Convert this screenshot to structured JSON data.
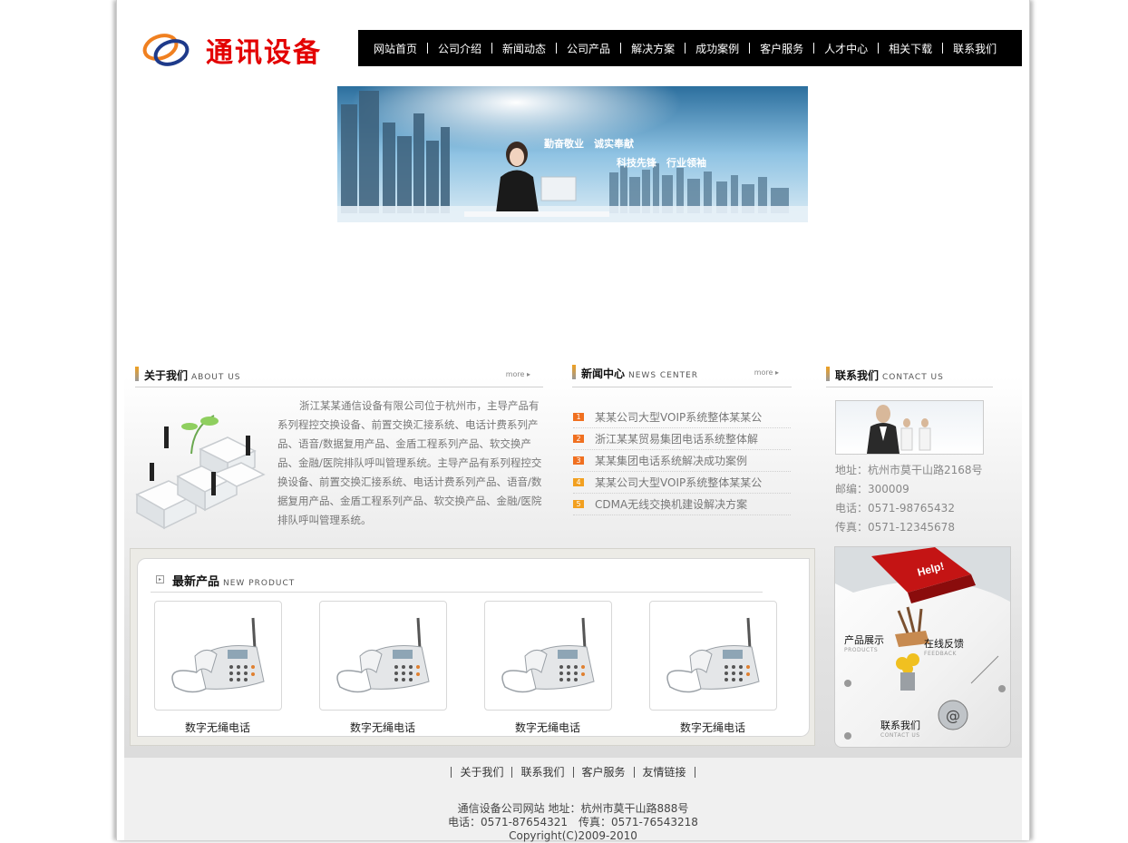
{
  "site": {
    "name": "通讯设备"
  },
  "nav": {
    "items": [
      "网站首页",
      "公司介绍",
      "新闻动态",
      "公司产品",
      "解决方案",
      "成功案例",
      "客户服务",
      "人才中心",
      "相关下载",
      "联系我们"
    ]
  },
  "banner": {
    "slogan1": "勤奋敬业　诚实奉献",
    "slogan2": "科技先锋　行业领袖"
  },
  "about": {
    "title": "关于我们",
    "subtitle": "ABOUT US",
    "more": "more",
    "text": "浙江某某通信设备有限公司位于杭州市，主导产品有系列程控交换设备、前置交换汇接系统、电话计费系列产品、语音/数据复用产品、金盾工程系列产品、软交换产品、金融/医院排队呼叫管理系统。主导产品有系列程控交换设备、前置交换汇接系统、电话计费系列产品、语音/数据复用产品、金盾工程系列产品、软交换产品、金融/医院排队呼叫管理系统。"
  },
  "news": {
    "title": "新闻中心",
    "subtitle": "NEWS CENTER",
    "more": "more",
    "items": [
      {
        "num": "1",
        "text": "某某公司大型VOIP系统整体某某公"
      },
      {
        "num": "2",
        "text": "浙江某某贸易集团电话系统整体解"
      },
      {
        "num": "3",
        "text": "某某集团电话系统解决成功案例"
      },
      {
        "num": "4",
        "text": "某某公司大型VOIP系统整体某某公"
      },
      {
        "num": "5",
        "text": "CDMA无线交换机建设解决方案"
      }
    ]
  },
  "contact": {
    "title": "联系我们",
    "subtitle": "CONTACT US",
    "address": "地址：杭州市莫干山路2168号",
    "postcode": "邮编：300009",
    "phone": "电话：0571-98765432",
    "fax": "传真：0571-12345678"
  },
  "products": {
    "title": "最新产品",
    "subtitle": "NEW PRODUCT",
    "items": [
      "数字无绳电话",
      "数字无绳电话",
      "数字无绳电话",
      "数字无绳电话"
    ]
  },
  "side_banner": {
    "help": "Help!",
    "product_show": "产品展示",
    "product_show_en": "PRODUCTS",
    "feedback": "在线反馈",
    "feedback_en": "FEEDBACK",
    "contact": "联系我们",
    "contact_en": "CONTACT US"
  },
  "footer": {
    "links": [
      "关于我们",
      "联系我们",
      "客户服务",
      "友情链接"
    ],
    "line1": "通信设备公司网站 地址：杭州市莫干山路888号",
    "line2": "电话：0571-87654321　传真：0571-76543218",
    "line3": "Copyright(C)2009-2010"
  },
  "colors": {
    "brand_red": "#e30000",
    "nav_bg": "#000000",
    "accent_orange": "#f07020"
  }
}
